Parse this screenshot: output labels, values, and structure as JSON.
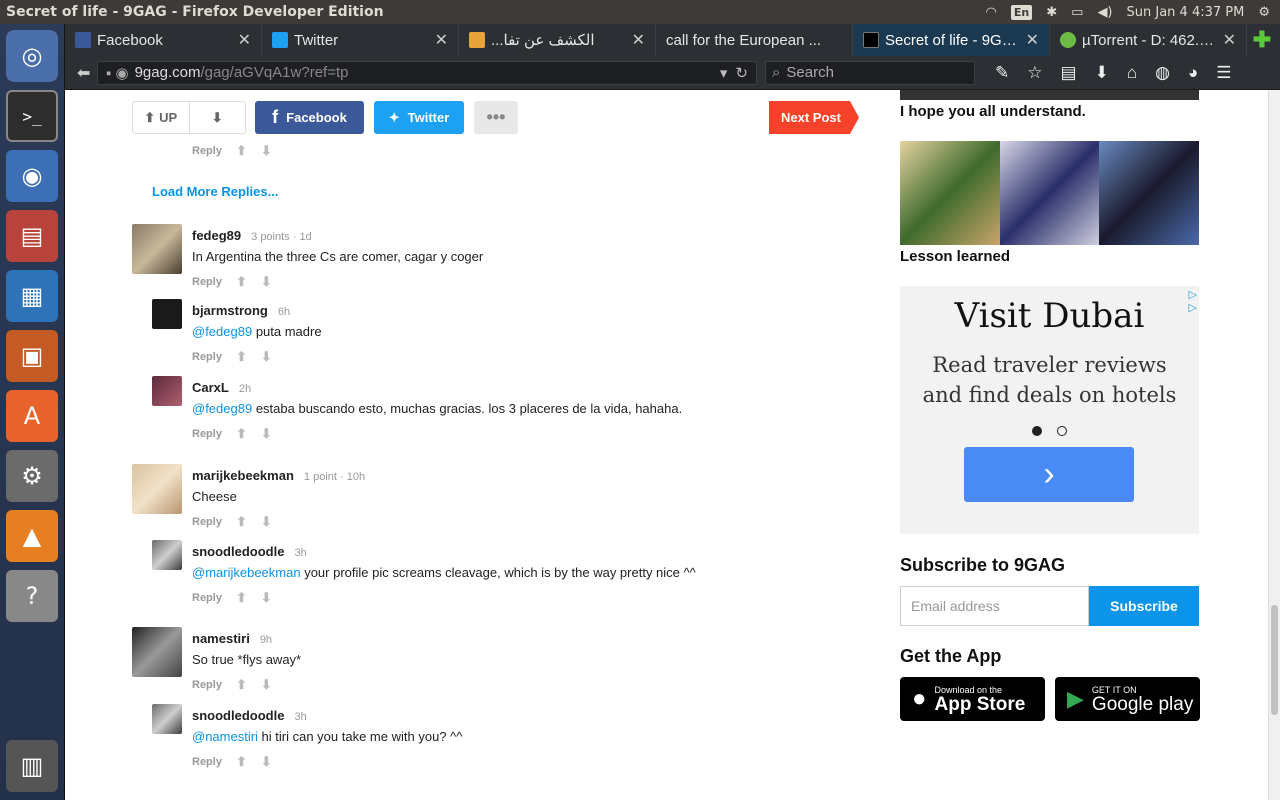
{
  "system": {
    "window_title": "Secret of life - 9GAG - Firefox Developer Edition",
    "keyboard": "En",
    "clock": "Sun Jan 4  4:37 PM"
  },
  "tabs": [
    {
      "label": "Facebook",
      "fav_color": "#3b5998"
    },
    {
      "label": "Twitter",
      "fav_color": "#1da1f2"
    },
    {
      "label": "...الكشف عن تفا",
      "fav_color": "#e8a33a"
    },
    {
      "label": "call for the European ...",
      "fav_color": ""
    },
    {
      "label": "Secret of life - 9GAG",
      "fav_color": "#000000"
    },
    {
      "label": "µTorrent - D: 462.0...",
      "fav_color": "#6dbb44"
    }
  ],
  "nav": {
    "url_host": "9gag.com",
    "url_path": "/gag/aGVqA1w?ref=tp",
    "search_placeholder": "Search"
  },
  "post_actions": {
    "up_label": "UP",
    "facebook_label": "Facebook",
    "twitter_label": "Twitter",
    "next_label": "Next Post"
  },
  "reply_label": "Reply",
  "load_more": "Load More Replies...",
  "comments": [
    {
      "user": "fedeg89",
      "meta": "3 points · 1d",
      "mention": "",
      "text": "In Argentina the three Cs are comer, cagar y coger"
    },
    {
      "user": "bjarmstrong",
      "meta": "6h",
      "mention": "@fedeg89",
      "text": " puta madre"
    },
    {
      "user": "CarxL",
      "meta": "2h",
      "mention": "@fedeg89",
      "text": " estaba buscando esto, muchas gracias. los 3 placeres de la vida, hahaha."
    },
    {
      "user": "marijkebeekman",
      "meta": "1 point · 10h",
      "mention": "",
      "text": "Cheese"
    },
    {
      "user": "snoodledoodle",
      "meta": "3h",
      "mention": "@marijkebeekman",
      "text": " your profile pic screams cleavage, which is by the way pretty nice ^^"
    },
    {
      "user": "namestiri",
      "meta": "9h",
      "mention": "",
      "text": "So true *flys away*"
    },
    {
      "user": "snoodledoodle",
      "meta": "3h",
      "mention": "@namestiri",
      "text": " hi tiri can you take me with you? ^^"
    }
  ],
  "sidebar": {
    "caption1": "I hope you all understand.",
    "caption2": "Lesson learned",
    "ad_title": "Visit Dubai",
    "ad_text": "Read traveler reviews and find deals on hotels",
    "subscribe_title": "Subscribe to 9GAG",
    "email_placeholder": "Email address",
    "subscribe_btn": "Subscribe",
    "app_title": "Get the App",
    "appstore_small": "Download on the",
    "appstore_big": "App Store",
    "gplay_small": "GET IT ON",
    "gplay_big": "Google play"
  }
}
